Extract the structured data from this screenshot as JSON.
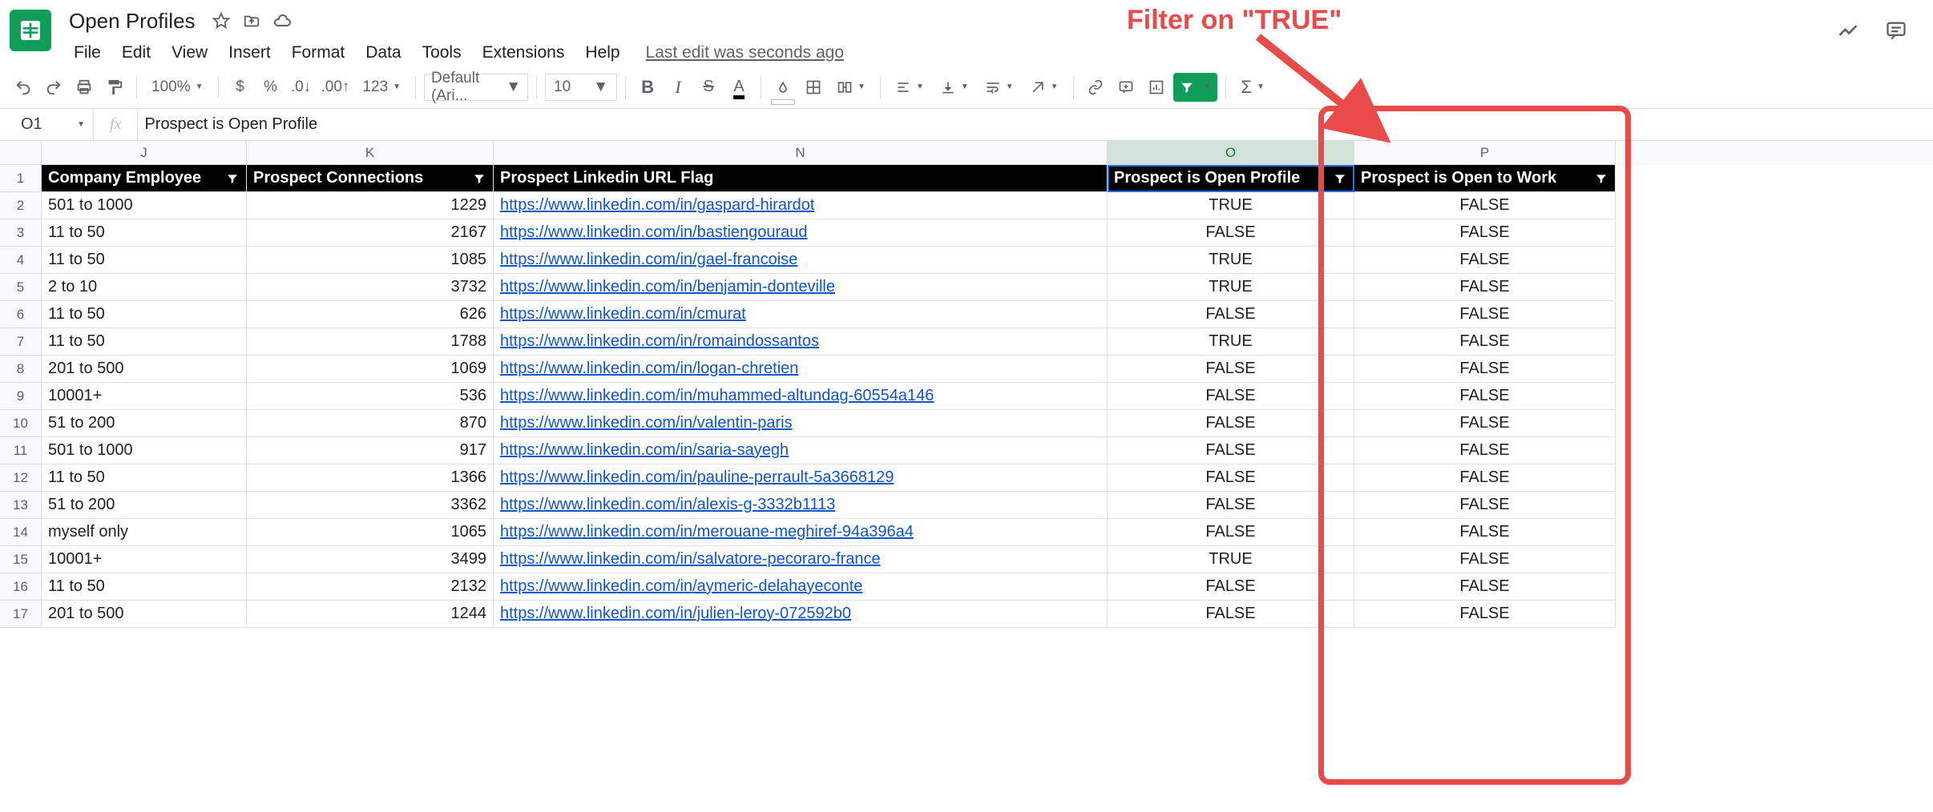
{
  "doc": {
    "title": "Open Profiles",
    "last_edit": "Last edit was seconds ago"
  },
  "menus": {
    "file": "File",
    "edit": "Edit",
    "view": "View",
    "insert": "Insert",
    "format": "Format",
    "data": "Data",
    "tools": "Tools",
    "extensions": "Extensions",
    "help": "Help"
  },
  "toolbar": {
    "zoom": "100%",
    "font": "Default (Ari...",
    "size": "10",
    "more_formats": "123"
  },
  "formula": {
    "name_box": "O1",
    "value": "Prospect is Open Profile"
  },
  "columns": {
    "J": "J",
    "K": "K",
    "N": "N",
    "O": "O",
    "P": "P"
  },
  "headers": {
    "J": "Company Employee",
    "K": "Prospect Connections",
    "N": "Prospect Linkedin URL Flag",
    "O": "Prospect is Open Profile",
    "P": "Prospect is Open to Work"
  },
  "rows": [
    {
      "n": "1"
    },
    {
      "n": "2",
      "J": "501 to 1000",
      "K": "1229",
      "N": "https://www.linkedin.com/in/gaspard-hirardot",
      "O": "TRUE",
      "P": "FALSE"
    },
    {
      "n": "3",
      "J": "11 to 50",
      "K": "2167",
      "N": "https://www.linkedin.com/in/bastiengouraud",
      "O": "FALSE",
      "P": "FALSE"
    },
    {
      "n": "4",
      "J": "11 to 50",
      "K": "1085",
      "N": "https://www.linkedin.com/in/gael-francoise",
      "O": "TRUE",
      "P": "FALSE"
    },
    {
      "n": "5",
      "J": "2 to 10",
      "K": "3732",
      "N": "https://www.linkedin.com/in/benjamin-donteville",
      "O": "TRUE",
      "P": "FALSE"
    },
    {
      "n": "6",
      "J": "11 to 50",
      "K": "626",
      "N": "https://www.linkedin.com/in/cmurat",
      "O": "FALSE",
      "P": "FALSE"
    },
    {
      "n": "7",
      "J": "11 to 50",
      "K": "1788",
      "N": "https://www.linkedin.com/in/romaindossantos",
      "O": "TRUE",
      "P": "FALSE"
    },
    {
      "n": "8",
      "J": "201 to 500",
      "K": "1069",
      "N": "https://www.linkedin.com/in/logan-chretien",
      "O": "FALSE",
      "P": "FALSE"
    },
    {
      "n": "9",
      "J": "10001+",
      "K": "536",
      "N": "https://www.linkedin.com/in/muhammed-altundag-60554a146",
      "O": "FALSE",
      "P": "FALSE"
    },
    {
      "n": "10",
      "J": "51 to 200",
      "K": "870",
      "N": "https://www.linkedin.com/in/valentin-paris",
      "O": "FALSE",
      "P": "FALSE"
    },
    {
      "n": "11",
      "J": "501 to 1000",
      "K": "917",
      "N": "https://www.linkedin.com/in/saria-sayegh",
      "O": "FALSE",
      "P": "FALSE"
    },
    {
      "n": "12",
      "J": "11 to 50",
      "K": "1366",
      "N": "https://www.linkedin.com/in/pauline-perrault-5a3668129",
      "O": "FALSE",
      "P": "FALSE"
    },
    {
      "n": "13",
      "J": "51 to 200",
      "K": "3362",
      "N": "https://www.linkedin.com/in/alexis-g-3332b1113",
      "O": "FALSE",
      "P": "FALSE"
    },
    {
      "n": "14",
      "J": "myself only",
      "K": "1065",
      "N": "https://www.linkedin.com/in/merouane-meghiref-94a396a4",
      "O": "FALSE",
      "P": "FALSE"
    },
    {
      "n": "15",
      "J": "10001+",
      "K": "3499",
      "N": "https://www.linkedin.com/in/salvatore-pecoraro-france",
      "O": "TRUE",
      "P": "FALSE"
    },
    {
      "n": "16",
      "J": "11 to 50",
      "K": "2132",
      "N": "https://www.linkedin.com/in/aymeric-delahayeconte",
      "O": "FALSE",
      "P": "FALSE"
    },
    {
      "n": "17",
      "J": "201 to 500",
      "K": "1244",
      "N": "https://www.linkedin.com/in/julien-leroy-072592b0",
      "O": "FALSE",
      "P": "FALSE"
    }
  ],
  "annotation": {
    "text": "Filter on \"TRUE\""
  }
}
